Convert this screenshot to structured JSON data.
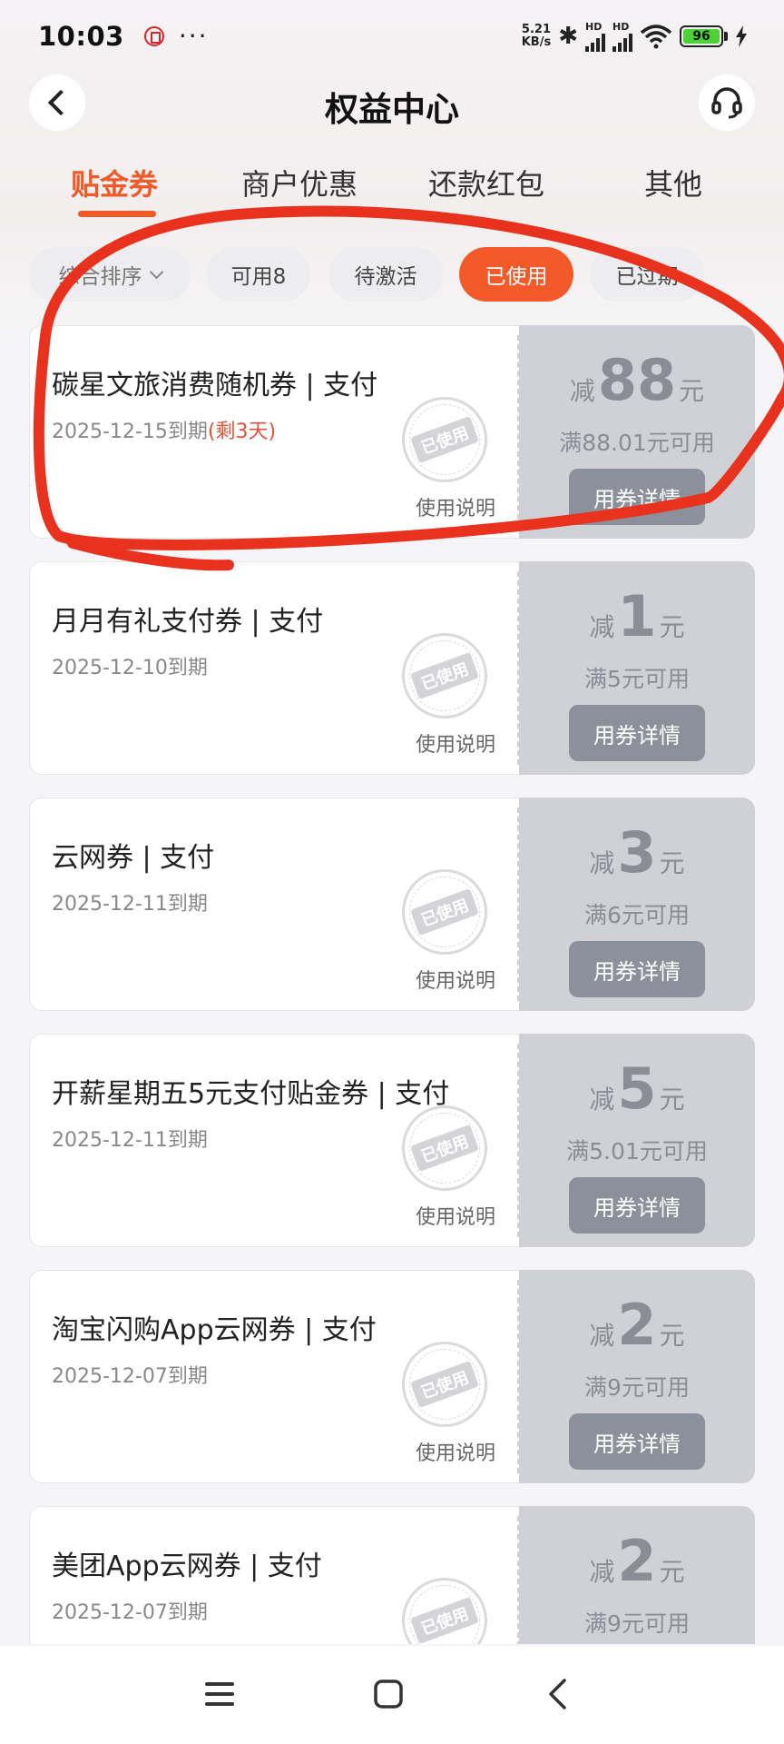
{
  "status_bar": {
    "time": "10:03",
    "dots": "···",
    "speed_value": "5.21",
    "speed_unit": "KB/s",
    "bluetooth_glyph": "✱",
    "hd1": "HD",
    "hd2": "HD",
    "battery": "96",
    "icons": [
      "app-notification-icon",
      "bluetooth-icon",
      "signal-icon",
      "wifi-icon",
      "battery-icon",
      "charging-icon"
    ]
  },
  "header": {
    "title": "权益中心",
    "back_icon": "chevron-left-icon",
    "support_icon": "headset-icon"
  },
  "tabs": [
    {
      "label": "贴金券",
      "active": true
    },
    {
      "label": "商户优惠",
      "active": false
    },
    {
      "label": "还款红包",
      "active": false
    },
    {
      "label": "其他",
      "active": false
    }
  ],
  "filters": {
    "sort_label": "综合排序",
    "chips": [
      {
        "label": "可用8",
        "active": false
      },
      {
        "label": "待激活",
        "active": false
      },
      {
        "label": "已使用",
        "active": true
      },
      {
        "label": "已过期",
        "active": false
      }
    ]
  },
  "coupon_common": {
    "stamp_text": "已使用",
    "usage_label": "使用说明",
    "detail_label": "用券详情",
    "amount_prefix": "减",
    "amount_unit": "元"
  },
  "coupons": [
    {
      "title": "碳星文旅消费随机券 | 支付",
      "expiry": "2025-12-15到期",
      "remaining": "(剩3天)",
      "amount": "88",
      "condition": "满88.01元可用"
    },
    {
      "title": "月月有礼支付券 | 支付",
      "expiry": "2025-12-10到期",
      "remaining": "",
      "amount": "1",
      "condition": "满5元可用"
    },
    {
      "title": "云网券 | 支付",
      "expiry": "2025-12-11到期",
      "remaining": "",
      "amount": "3",
      "condition": "满6元可用"
    },
    {
      "title": "开薪星期五5元支付贴金券 | 支付",
      "expiry": "2025-12-11到期",
      "remaining": "",
      "amount": "5",
      "condition": "满5.01元可用"
    },
    {
      "title": "淘宝闪购App云网券 | 支付",
      "expiry": "2025-12-07到期",
      "remaining": "",
      "amount": "2",
      "condition": "满9元可用"
    },
    {
      "title": "美团App云网券 | 支付",
      "expiry": "2025-12-07到期",
      "remaining": "",
      "amount": "2",
      "condition": "满9元可用"
    }
  ],
  "annotation_color": "#e8321e",
  "accent_color": "#f05a28",
  "nav_icons": [
    "menu-icon",
    "home-square-icon",
    "back-icon"
  ]
}
